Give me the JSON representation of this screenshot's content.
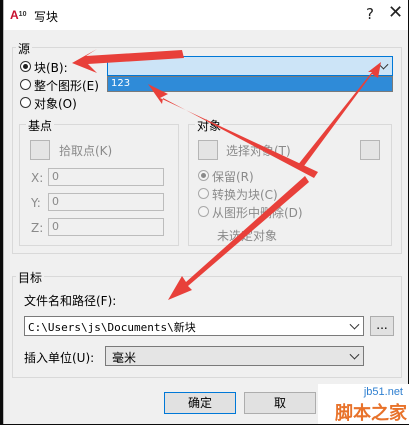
{
  "window": {
    "title": "写块",
    "app_icon_text": "A",
    "app_icon_sub": "10",
    "help_glyph": "?",
    "close_glyph": "✕"
  },
  "source": {
    "label": "源",
    "radio_block": "块(B):",
    "radio_whole": "整个图形(E)",
    "radio_objects": "对象(O)",
    "selected": "block",
    "block_combo_value": "",
    "dropdown_items": [
      "123"
    ]
  },
  "base_point": {
    "label": "基点",
    "pick_label": "拾取点(K)",
    "x_label": "X:",
    "x_value": "0",
    "y_label": "Y:",
    "y_value": "0",
    "z_label": "Z:",
    "z_value": "0"
  },
  "objects": {
    "label": "对象",
    "select_label": "选择对象(T)",
    "retain": "保留(R)",
    "convert": "转换为块(C)",
    "delete": "从图形中删除(D)",
    "status": "未选定对象"
  },
  "target": {
    "label": "目标",
    "file_label": "文件名和路径(F):",
    "file_value": "C:\\Users\\js\\Documents\\新块",
    "browse_label": "...",
    "units_label": "插入单位(U):",
    "units_value": "毫米"
  },
  "buttons": {
    "ok": "确定",
    "cancel": "取"
  },
  "watermark": {
    "site": "jb51.net",
    "name": "脚本之家"
  },
  "colors": {
    "arrow": "#e8403a",
    "selection": "#2f8bd8"
  }
}
